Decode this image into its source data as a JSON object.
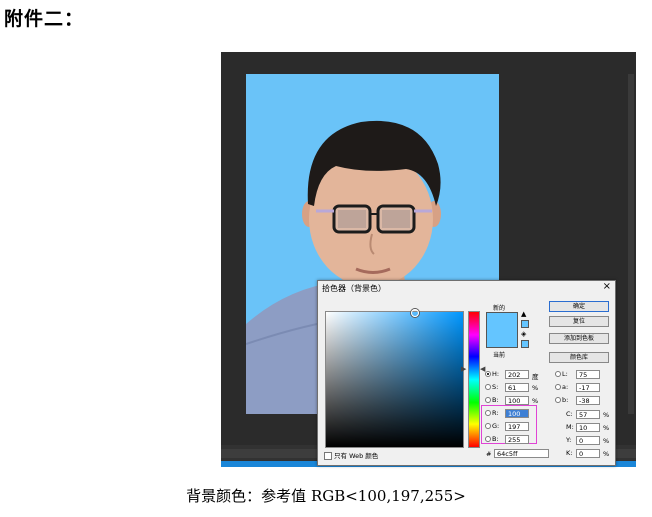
{
  "document": {
    "heading": "附件二：",
    "caption": "背景颜色：参考值 RGB<100,197,255>"
  },
  "colors": {
    "background_photo": "#6ac3f8",
    "picked": "#64c5ff",
    "highlight": "#e043d5"
  },
  "picker": {
    "title": "拾色器（背景色）",
    "close_label": "×",
    "new_label": "新的",
    "current_label": "当前",
    "buttons": {
      "ok": "确定",
      "reset": "复位",
      "add_to_swatches": "添加到色板",
      "color_libraries": "颜色库"
    },
    "hsb": [
      {
        "label": "H:",
        "value": "202",
        "unit": "度",
        "selected": true
      },
      {
        "label": "S:",
        "value": "61",
        "unit": "%"
      },
      {
        "label": "B:",
        "value": "100",
        "unit": "%"
      }
    ],
    "rgb": [
      {
        "label": "R:",
        "value": "100"
      },
      {
        "label": "G:",
        "value": "197"
      },
      {
        "label": "B:",
        "value": "255"
      }
    ],
    "lab": [
      {
        "label": "L:",
        "value": "75"
      },
      {
        "label": "a:",
        "value": "-17"
      },
      {
        "label": "b:",
        "value": "-38"
      }
    ],
    "cmyk": [
      {
        "label": "C:",
        "value": "57",
        "unit": "%"
      },
      {
        "label": "M:",
        "value": "10",
        "unit": "%"
      },
      {
        "label": "Y:",
        "value": "0",
        "unit": "%"
      },
      {
        "label": "K:",
        "value": "0",
        "unit": "%"
      }
    ],
    "hex_label": "#",
    "hex_value": "64c5ff",
    "web_only": "只有 Web 颜色"
  }
}
